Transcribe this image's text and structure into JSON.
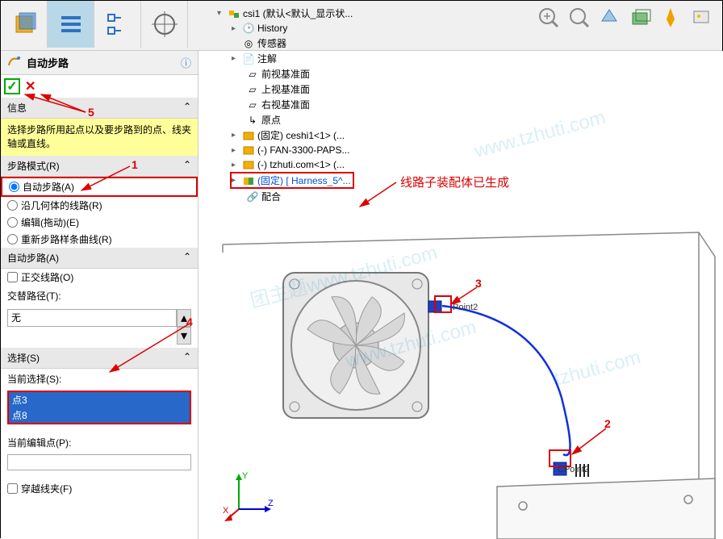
{
  "toolbar": {
    "tabs": [
      "feature",
      "config",
      "tree",
      "view"
    ]
  },
  "panel": {
    "title": "自动步路",
    "info_hdr": "信息",
    "info_msg": "选择步路所用起点以及要步路到的点、线夹轴或直线。",
    "mode_hdr": "步路模式(R)",
    "mode_opts": [
      "自动步路(A)",
      "沿几何体的线路(R)",
      "编辑(拖动)(E)",
      "重新步路样条曲线(R)"
    ],
    "auto_hdr": "自动步路(A)",
    "ortho_label": "正交线路(O)",
    "diam_label": "交替路径(T):",
    "diam_value": "无",
    "select_hdr": "选择(S)",
    "curr_sel_label": "当前选择(S):",
    "selections": [
      "点3",
      "点8"
    ],
    "curr_edit_label": "当前编辑点(P):",
    "through_clip": "穿越线夹(F)"
  },
  "tree": {
    "root": "csi1  (默认<默认_显示状...",
    "items": [
      {
        "icon": "history",
        "text": "History"
      },
      {
        "icon": "sensor",
        "text": "传感器"
      },
      {
        "icon": "annot",
        "text": "注解"
      },
      {
        "icon": "plane",
        "text": "前视基准面"
      },
      {
        "icon": "plane",
        "text": "上视基准面"
      },
      {
        "icon": "plane",
        "text": "右视基准面"
      },
      {
        "icon": "origin",
        "text": "原点"
      },
      {
        "icon": "asm",
        "text": "(固定) ceshi1<1> (..."
      },
      {
        "icon": "asm",
        "text": "(-) FAN-3300-PAPS..."
      },
      {
        "icon": "asm",
        "text": "(-) tzhuti.com<1> (..."
      },
      {
        "icon": "asm",
        "text": "(固定) [ Harness_5^...",
        "hl": true
      },
      {
        "icon": "mate",
        "text": "配合"
      }
    ]
  },
  "annotations": {
    "note1": "1",
    "note2": "2",
    "note3": "3",
    "note4": "4",
    "note5": "5",
    "harness_text": "线路子装配体已生成",
    "point_label": "Point2",
    "point_label2": "CPoint2"
  },
  "view_btns": [
    "zoom-fit",
    "zoom-area",
    "section",
    "display",
    "appearance",
    "scene"
  ],
  "axis": {
    "x": "X",
    "y": "Y",
    "z": "Z"
  }
}
